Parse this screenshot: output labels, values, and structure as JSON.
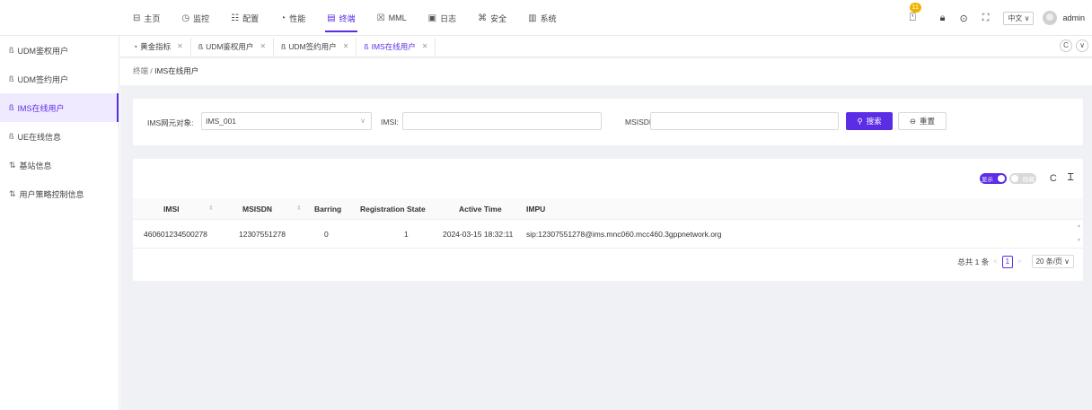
{
  "topnav": {
    "items": [
      {
        "icon": "home-icon",
        "glyph": "⊟",
        "label": "主页"
      },
      {
        "icon": "monitor-icon",
        "glyph": "◷",
        "label": "监控"
      },
      {
        "icon": "config-icon",
        "glyph": "☷",
        "label": "配置"
      },
      {
        "icon": "performance-icon",
        "glyph": "◔",
        "label": "性能"
      },
      {
        "icon": "terminal-icon",
        "glyph": "▤",
        "label": "终端"
      },
      {
        "icon": "mml-icon",
        "glyph": "☒",
        "label": "MML"
      },
      {
        "icon": "log-icon",
        "glyph": "▣",
        "label": "日志"
      },
      {
        "icon": "security-icon",
        "glyph": "⌘",
        "label": "安全"
      },
      {
        "icon": "system-icon",
        "glyph": "▥",
        "label": "系统"
      }
    ],
    "active_index": 4
  },
  "toolbar": {
    "notification_count": "11",
    "language": "中文 ∨",
    "username": "admin"
  },
  "sidebar": {
    "items": [
      {
        "icon": "ß",
        "label": "UDM鉴权用户"
      },
      {
        "icon": "ß",
        "label": "UDM签约用户"
      },
      {
        "icon": "ß",
        "label": "IMS在线用户"
      },
      {
        "icon": "ß",
        "label": "UE在线信息"
      },
      {
        "icon": "⇅",
        "label": "基站信息"
      },
      {
        "icon": "⇅",
        "label": "用户策略控制信息"
      }
    ],
    "active_index": 2
  },
  "tabs": [
    {
      "icon": "◔",
      "label": "黄金指标"
    },
    {
      "icon": "ß",
      "label": "UDM鉴权用户"
    },
    {
      "icon": "ß",
      "label": "UDM签约用户"
    },
    {
      "icon": "ß",
      "label": "IMS在线用户"
    }
  ],
  "tabs_active_index": 3,
  "breadcrumb": {
    "parent": "终端",
    "separator": " / ",
    "current": "IMS在线用户"
  },
  "search": {
    "ne_label": "IMS网元对象:",
    "ne_value": "IMS_001",
    "imsi_label": "IMSI:",
    "imsi_value": "",
    "msisdn_label": "MSISDN:",
    "msisdn_value": "",
    "search_button": "搜索",
    "reset_button": "重置"
  },
  "table": {
    "toggle_show": "显示",
    "toggle_hide": "隐藏",
    "columns": [
      "IMSI",
      "MSISDN",
      "Barring",
      "Registration State",
      "Active Time",
      "IMPU"
    ],
    "rows": [
      [
        "460601234500278",
        "12307551278",
        "0",
        "1",
        "2024-03-15 18:32:11",
        "sip:12307551278@ims.mnc060.mcc460.3gppnetwork.org"
      ]
    ]
  },
  "pagination": {
    "total_text": "总共 1 条",
    "current_page": "1",
    "page_size": "20 条/页 ∨"
  }
}
